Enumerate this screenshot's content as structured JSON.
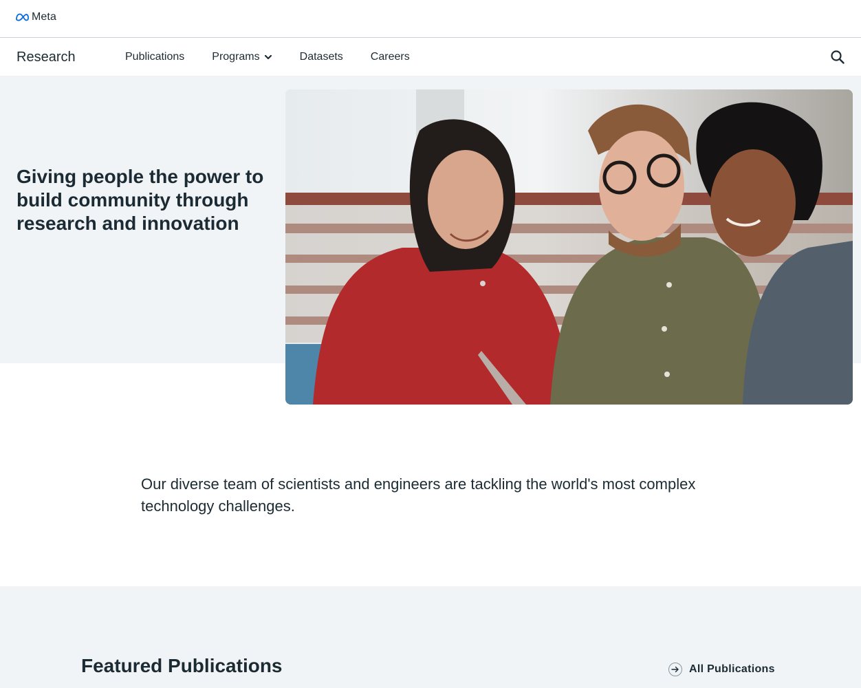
{
  "topbar": {
    "logo_text": "Meta"
  },
  "nav": {
    "brand": "Research",
    "items": [
      {
        "label": "Publications"
      },
      {
        "label": "Programs",
        "has_dropdown": true
      },
      {
        "label": "Datasets"
      },
      {
        "label": "Careers"
      }
    ],
    "search_icon": "search-icon"
  },
  "hero": {
    "title": "Giving people the power to build community through research and innovation",
    "image": "photo-three-people-looking-at-laptop"
  },
  "intro": {
    "text": "Our diverse team of scientists and engineers are tackling the world's most complex technology challenges."
  },
  "featured": {
    "title": "Featured Publications",
    "link_label": "All Publications",
    "link_icon": "arrow-right-circle-icon"
  },
  "colors": {
    "text": "#1c2b33",
    "hero_bg": "#f1f4f7",
    "meta_blue": "#0668e1",
    "divider": "#cbd2d9"
  }
}
